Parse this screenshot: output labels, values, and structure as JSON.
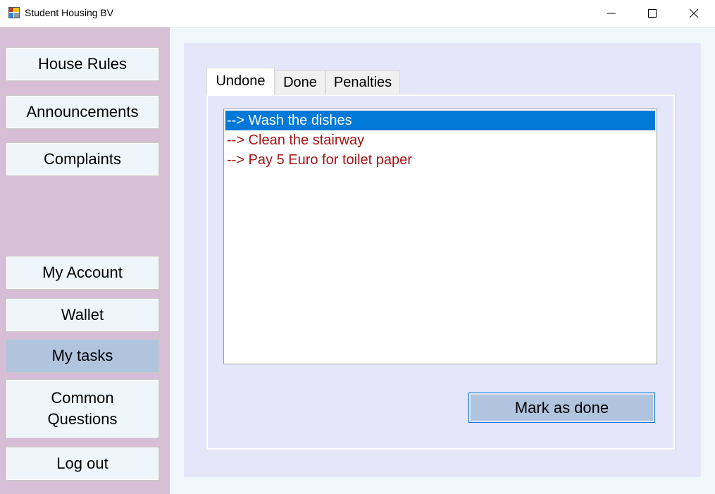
{
  "window": {
    "title": "Student Housing BV"
  },
  "sidebar": {
    "items": [
      {
        "label": "House Rules"
      },
      {
        "label": "Announcements"
      },
      {
        "label": "Complaints"
      },
      {
        "label": "My Account"
      },
      {
        "label": "Wallet"
      },
      {
        "label": "My tasks",
        "active": true
      },
      {
        "label_line1": "Common",
        "label_line2": "Questions"
      },
      {
        "label": "Log out"
      }
    ]
  },
  "tabs": [
    {
      "label": "Undone",
      "active": true
    },
    {
      "label": "Done"
    },
    {
      "label": "Penalties"
    }
  ],
  "tasks": [
    {
      "text": "--> Wash the dishes",
      "selected": true
    },
    {
      "text": "--> Clean the stairway"
    },
    {
      "text": "--> Pay 5 Euro for toilet paper"
    }
  ],
  "actions": {
    "mark_done_label": "Mark as done"
  },
  "colors": {
    "sidebar_bg": "#d7bed7",
    "panel_bg": "#e6e6fa",
    "active_button_bg": "#b0c4de",
    "selection_bg": "#0078d7",
    "task_text": "#a31515"
  },
  "icons": {
    "app": "app-icon",
    "minimize": "minimize-icon",
    "maximize": "maximize-icon",
    "close": "close-icon"
  }
}
